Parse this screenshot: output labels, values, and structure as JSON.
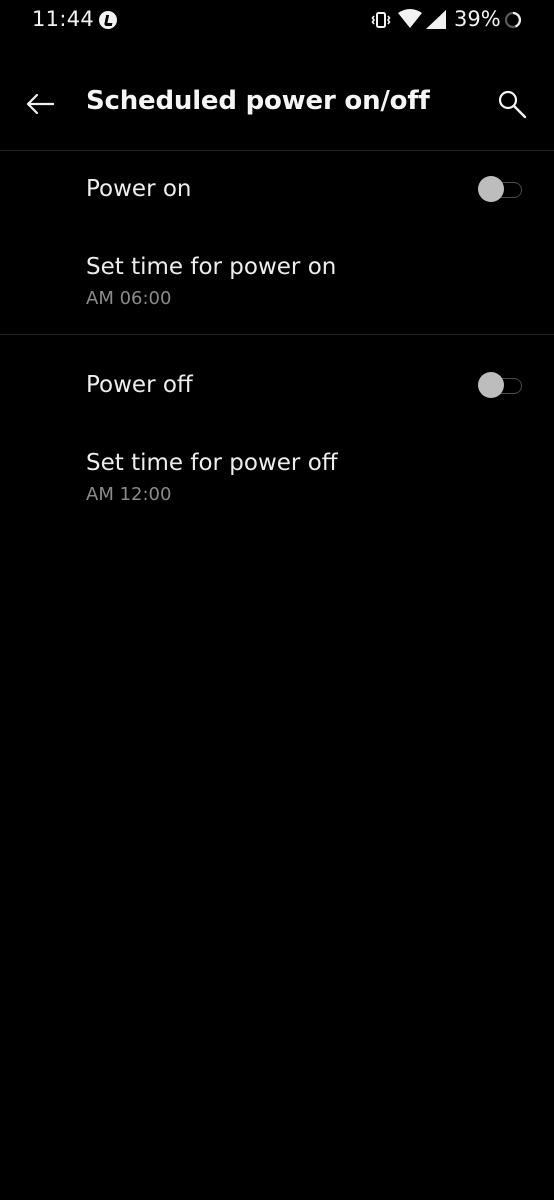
{
  "status_bar": {
    "time": "11:44",
    "battery_percent": "39%",
    "icons": [
      "music-note-icon",
      "vibrate-icon",
      "wifi-icon",
      "cell-signal-icon",
      "battery-charging-icon"
    ]
  },
  "app_bar": {
    "title": "Scheduled power on/off",
    "back_icon": "arrow-left-icon",
    "search_icon": "search-icon"
  },
  "sections": {
    "power_on": {
      "toggle_label": "Power on",
      "toggle_enabled": false,
      "time_label": "Set time for power on",
      "time_value": "AM 06:00"
    },
    "power_off": {
      "toggle_label": "Power off",
      "toggle_enabled": false,
      "time_label": "Set time for power off",
      "time_value": "AM 12:00"
    }
  },
  "colors": {
    "background": "#000000",
    "text_primary": "#ededed",
    "text_secondary": "#8a8a8a",
    "switch_thumb_off": "#bdbdbd"
  }
}
